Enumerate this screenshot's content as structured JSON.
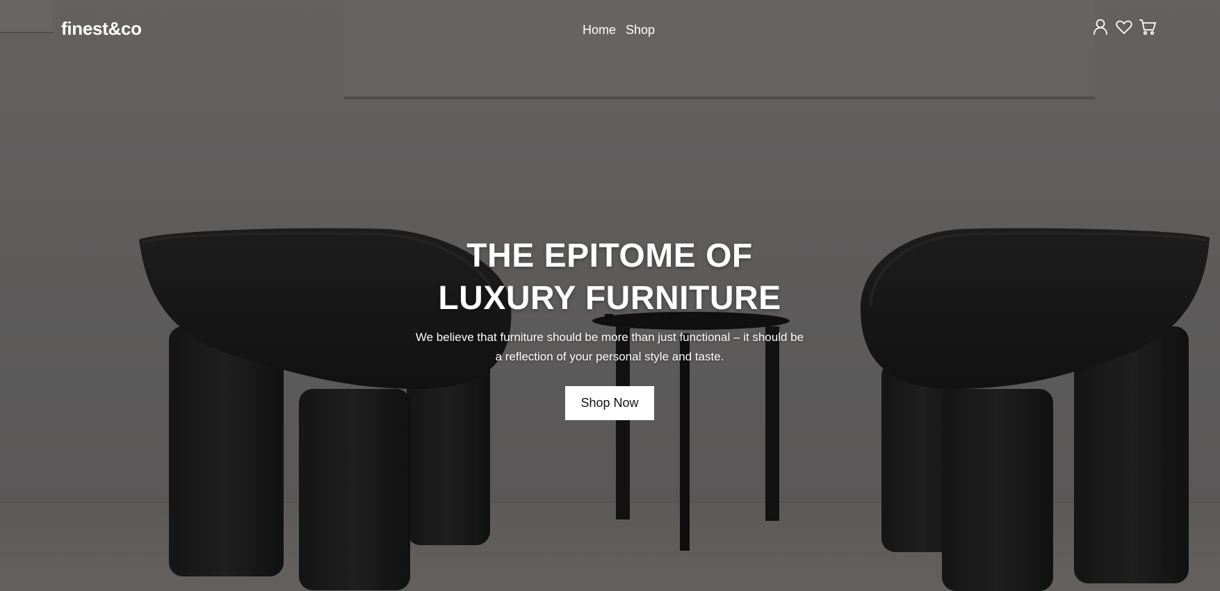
{
  "header": {
    "logo": "finest&co",
    "nav": [
      {
        "label": "Home"
      },
      {
        "label": "Shop"
      }
    ],
    "icons": [
      "user-icon",
      "heart-icon",
      "cart-icon"
    ]
  },
  "hero": {
    "title_line1": "THE EPITOME OF",
    "title_line2": "LUXURY FURNITURE",
    "subtitle": "We believe that furniture should be more than just functional – it should be a reflection of your personal style and taste.",
    "cta_label": "Shop Now"
  },
  "colors": {
    "text": "#ffffff",
    "button_bg": "#ffffff",
    "button_text": "#111111"
  }
}
